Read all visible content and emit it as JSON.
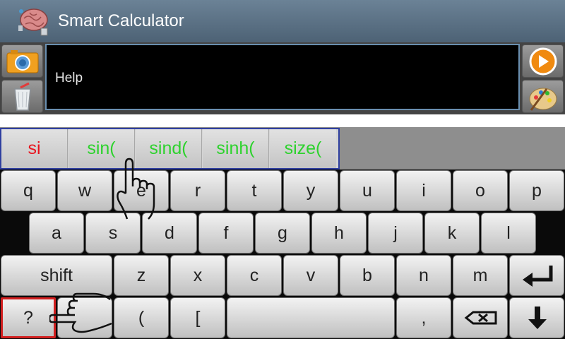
{
  "app": {
    "title": "Smart Calculator"
  },
  "display": {
    "text": "Help"
  },
  "suggestions": [
    {
      "text": "si",
      "color": "#e8141e"
    },
    {
      "text": "sin(",
      "color": "#2ed22e"
    },
    {
      "text": "sind(",
      "color": "#2ed22e"
    },
    {
      "text": "sinh(",
      "color": "#2ed22e"
    },
    {
      "text": "size(",
      "color": "#2ed22e"
    }
  ],
  "keyboard": {
    "row1": [
      "q",
      "w",
      "e",
      "r",
      "t",
      "y",
      "u",
      "i",
      "o",
      "p"
    ],
    "row2": [
      "a",
      "s",
      "d",
      "f",
      "g",
      "h",
      "j",
      "k",
      "l"
    ],
    "row3": {
      "shift": "shift",
      "letters": [
        "z",
        "x",
        "c",
        "v",
        "b",
        "n",
        "m"
      ],
      "enter_icon": "enter-icon"
    },
    "row4": {
      "question": "?",
      "paren": "(",
      "bracket": "[",
      "comma": ",",
      "backspace_icon": "backspace-icon",
      "down_icon": "down-arrow-icon"
    }
  },
  "icons": {
    "app": "brain-icon",
    "camera": "camera-icon",
    "clear": "trash-icon",
    "run": "play-icon",
    "theme": "palette-icon",
    "pointer_hand": "pointing-hand-icon"
  },
  "colors": {
    "titlebar": "#5a7185",
    "display_border": "#6a8fb0",
    "suggestion_border": "#2f3fa0",
    "play_orange": "#f08a10",
    "selected_key_border": "#d11f1f"
  }
}
